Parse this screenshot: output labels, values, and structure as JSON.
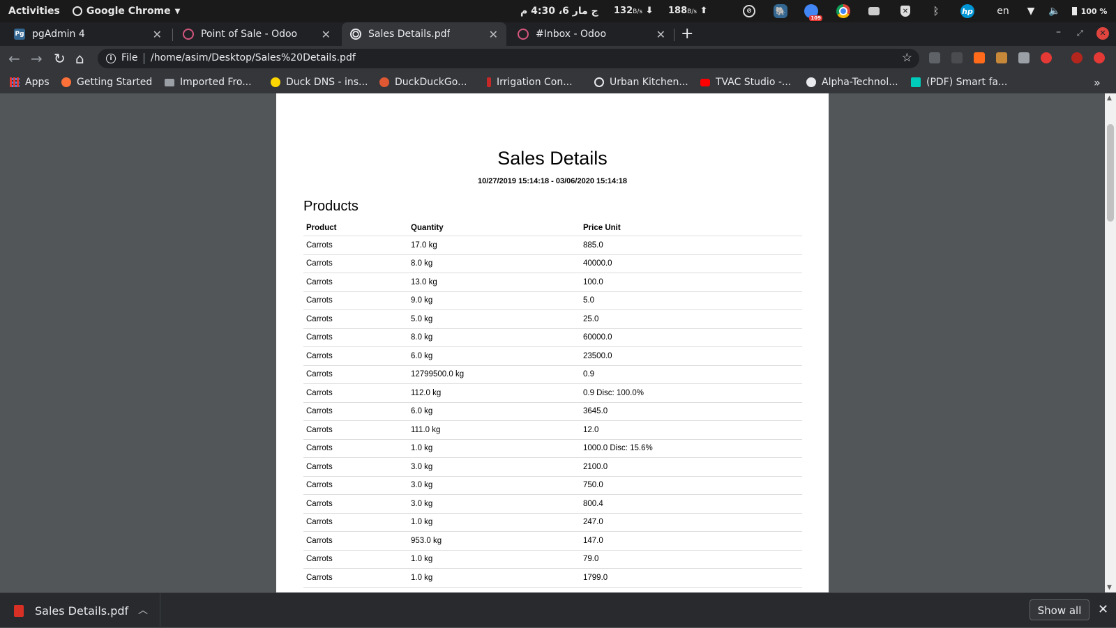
{
  "system_bar": {
    "activities": "Activities",
    "app_name": "Google Chrome",
    "clock": "ج مار 6، 4:30 م",
    "net_down_value": "132",
    "net_down_unit": "B/s",
    "net_up_value": "188",
    "net_up_unit": "B/s",
    "notify_badge": "109",
    "keyboard_layout": "en",
    "battery": "100 %"
  },
  "tabs": [
    {
      "title": "pgAdmin 4",
      "favicon": "pgadmin-icon",
      "color": "#336791"
    },
    {
      "title": "Point of Sale - Odoo",
      "favicon": "odoo-icon",
      "color": "#d5567e"
    },
    {
      "title": "Sales Details.pdf",
      "favicon": "globe-icon",
      "color": "#e8eaed",
      "active": true
    },
    {
      "title": "#Inbox - Odoo",
      "favicon": "odoo-icon",
      "color": "#d5567e"
    }
  ],
  "toolbar": {
    "scheme": "File",
    "url": "/home/asim/Desktop/Sales%20Details.pdf"
  },
  "bookmarks": [
    {
      "label": "Apps",
      "icon": "apps-grid-icon"
    },
    {
      "label": "Getting Started",
      "icon": "firefox-icon"
    },
    {
      "label": "Imported Fro...",
      "icon": "folder-icon"
    },
    {
      "label": "Duck DNS - ins...",
      "icon": "duckdns-icon"
    },
    {
      "label": "DuckDuckGo...",
      "icon": "duckduckgo-icon"
    },
    {
      "label": "Irrigation Con...",
      "icon": "irrigation-icon"
    },
    {
      "label": "Urban Kitchen...",
      "icon": "globe-icon"
    },
    {
      "label": "TVAC Studio -...",
      "icon": "youtube-icon"
    },
    {
      "label": "Alpha-Technol...",
      "icon": "github-icon"
    },
    {
      "label": "(PDF) Smart fa...",
      "icon": "researchgate-icon"
    }
  ],
  "document": {
    "title": "Sales Details",
    "date_range": "10/27/2019 15:14:18 - 03/06/2020 15:14:18",
    "section": "Products",
    "columns": [
      "Product",
      "Quantity",
      "Price Unit"
    ],
    "rows": [
      [
        "Carrots",
        "17.0 kg",
        "885.0"
      ],
      [
        "Carrots",
        "8.0 kg",
        "40000.0"
      ],
      [
        "Carrots",
        "13.0 kg",
        "100.0"
      ],
      [
        "Carrots",
        "9.0 kg",
        "5.0"
      ],
      [
        "Carrots",
        "5.0 kg",
        "25.0"
      ],
      [
        "Carrots",
        "8.0 kg",
        "60000.0"
      ],
      [
        "Carrots",
        "6.0 kg",
        "23500.0"
      ],
      [
        "Carrots",
        "12799500.0 kg",
        "0.9"
      ],
      [
        "Carrots",
        "112.0 kg",
        "0.9 Disc: 100.0%"
      ],
      [
        "Carrots",
        "6.0 kg",
        "3645.0"
      ],
      [
        "Carrots",
        "111.0 kg",
        "12.0"
      ],
      [
        "Carrots",
        "1.0 kg",
        "1000.0 Disc: 15.6%"
      ],
      [
        "Carrots",
        "3.0 kg",
        "2100.0"
      ],
      [
        "Carrots",
        "3.0 kg",
        "750.0"
      ],
      [
        "Carrots",
        "3.0 kg",
        "800.4"
      ],
      [
        "Carrots",
        "1.0 kg",
        "247.0"
      ],
      [
        "Carrots",
        "953.0 kg",
        "147.0"
      ],
      [
        "Carrots",
        "1.0 kg",
        "79.0"
      ],
      [
        "Carrots",
        "1.0 kg",
        "1799.0"
      ]
    ]
  },
  "download_shelf": {
    "file_name": "Sales Details.pdf",
    "show_all": "Show all"
  }
}
